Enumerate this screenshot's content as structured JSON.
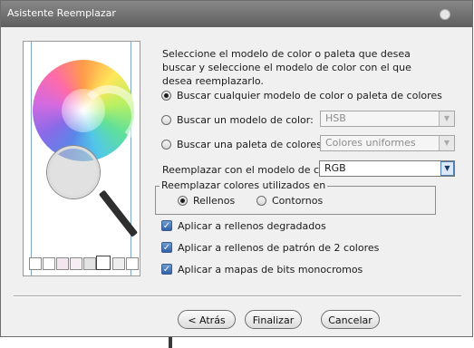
{
  "window": {
    "title": "Asistente Reemplazar"
  },
  "description": "Seleccione el modelo de color o paleta que desea buscar y seleccione el modelo de color con el que desea reemplazarlo.",
  "search": {
    "any_label": "Buscar cualquier modelo de color o paleta de colores",
    "any_selected": true,
    "model_label": "Buscar un modelo de color:",
    "model_value": "HSB",
    "palette_label": "Buscar una paleta de colores:",
    "palette_value": "Colores uniformes"
  },
  "replace": {
    "label": "Reemplazar con el modelo de color:",
    "value": "RGB"
  },
  "colors_used": {
    "legend": "Reemplazar colores utilizados en",
    "fills_label": "Rellenos",
    "fills_selected": true,
    "outlines_label": "Contornos"
  },
  "options": [
    {
      "label": "Aplicar a rellenos degradados",
      "checked": true
    },
    {
      "label": "Aplicar a rellenos de patrón de 2 colores",
      "checked": true
    },
    {
      "label": "Aplicar a mapas de bits monocromos",
      "checked": true
    }
  ],
  "buttons": {
    "back": "< Atrás",
    "finish": "Finalizar",
    "cancel": "Cancelar"
  },
  "icons": {
    "close": "close-dot-icon",
    "dropdown": "chevron-down-icon",
    "magnifier": "magnifier-icon",
    "color_wheel": "color-wheel-icon"
  }
}
